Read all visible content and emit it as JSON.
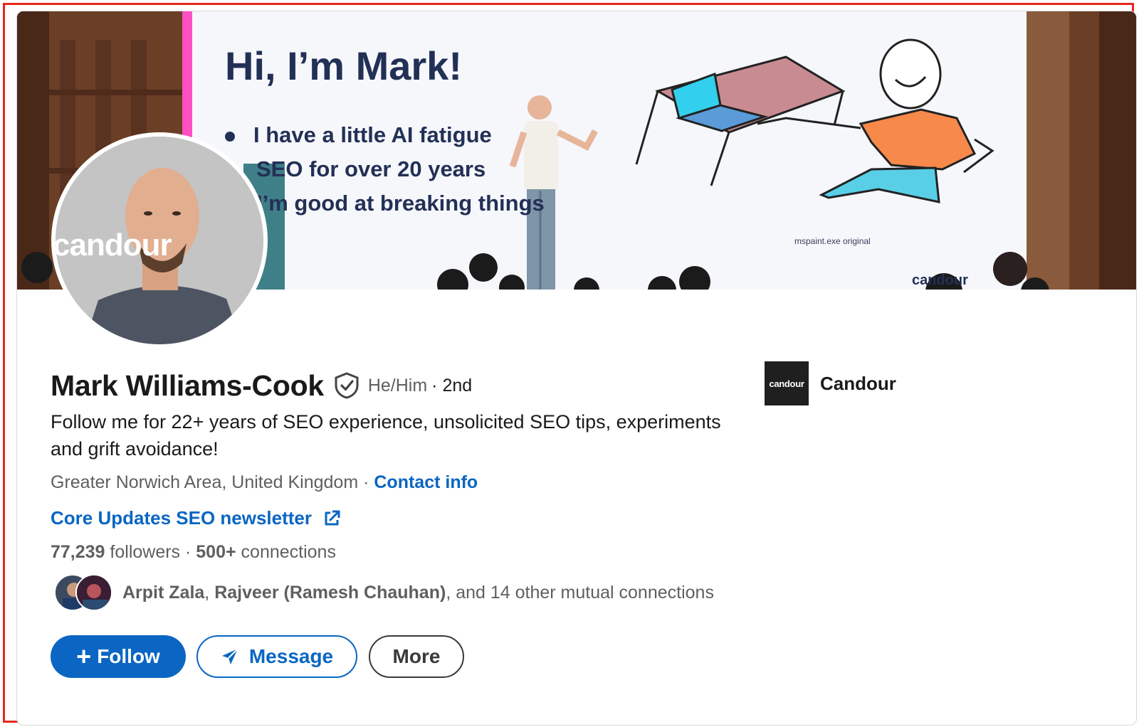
{
  "banner": {
    "slide_title": "Hi, I’m Mark!",
    "bullets": [
      "I have a little AI fatigue",
      "SEO for over 20 years",
      "I’m good at breaking things"
    ],
    "caption": "mspaint.exe original",
    "slide_logo": "candour"
  },
  "avatar": {
    "overlay_text": "candour"
  },
  "profile": {
    "name": "Mark Williams-Cook",
    "pronouns": "He/Him",
    "degree": "· 2nd",
    "headline": "Follow me for 22+ years of SEO experience, unsolicited SEO tips, experiments and grift avoidance!",
    "location": "Greater Norwich Area, United Kingdom",
    "location_separator": " · ",
    "contact_info": "Contact info",
    "newsletter": "Core Updates SEO newsletter",
    "followers_count": "77,239",
    "followers_label": " followers",
    "stats_separator": "  · ",
    "connections_count": "500+",
    "connections_label": " connections",
    "mutual_name_1": "Arpit Zala",
    "mutual_sep": ", ",
    "mutual_name_2": "Rajveer (Ramesh Chauhan)",
    "mutual_rest": ", and 14 other mutual connections"
  },
  "company": {
    "logo_text": "candour",
    "name": "Candour"
  },
  "actions": {
    "follow": "Follow",
    "message": "Message",
    "more": "More"
  },
  "colors": {
    "accent": "#0a66c2",
    "frame": "#e8281c",
    "slide_text": "#233056"
  },
  "icons": {
    "verified": "shield-check-icon",
    "external": "external-link-icon",
    "plus": "plus-icon",
    "send": "paper-plane-icon"
  }
}
